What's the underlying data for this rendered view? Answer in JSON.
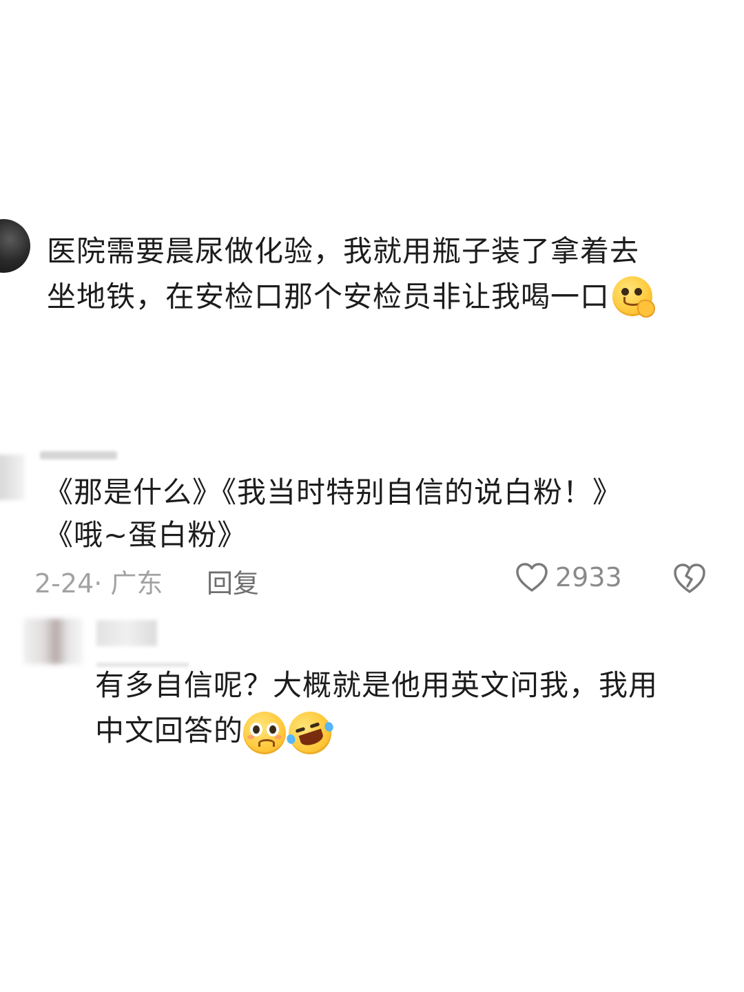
{
  "post": {
    "line1": "医院需要晨尿做化验，我就用瓶子装了拿着去",
    "line2": "坐地铁，在安检口那个安检员非让我喝一口",
    "emoji": "smirk-face-emoji"
  },
  "comment": {
    "line1": "《那是什么》《我当时特别自信的说白粉！》",
    "line2": "《哦~蛋白粉》",
    "date_location": "2-24· 广东",
    "reply_label": "回复",
    "like_count": "2933",
    "like_icon": "heart-outline-icon",
    "dislike_icon": "broken-heart-icon"
  },
  "reply": {
    "line1": "有多自信呢？大概就是他用英文问我，我用",
    "line2": "中文回答的",
    "emojis": [
      "pleading-face-emoji",
      "rofl-emoji"
    ]
  }
}
